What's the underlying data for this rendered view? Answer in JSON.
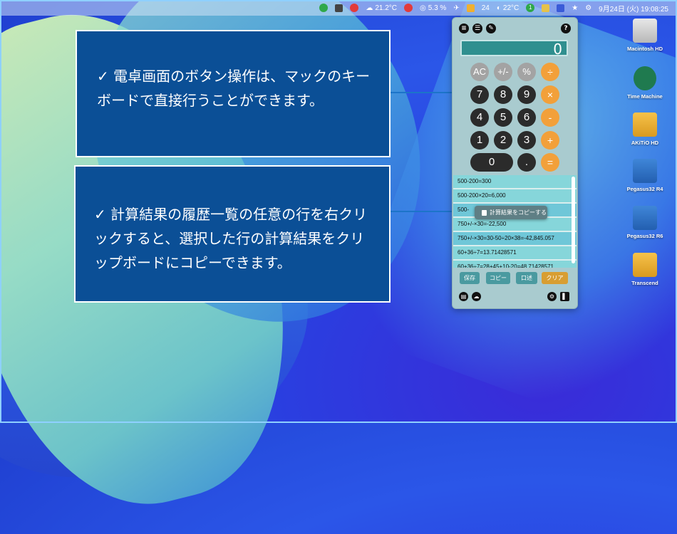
{
  "menubar": {
    "weather": "21.2°C",
    "cpu": "5.3 %",
    "date_badge": "24",
    "temperature2": "22°C",
    "badge_count": "1",
    "datetime": "9月24日 (火)  19:08:25",
    "colors": {
      "green": "#2fa84a",
      "red": "#e23b3b",
      "teal": "#27a6a0"
    }
  },
  "callouts": [
    {
      "text": "✓ 電卓画面のボタン操作は、マックのキーボードで直接行うことができます。"
    },
    {
      "text": "✓ 計算結果の履歴一覧の任意の行を右クリックすると、選択した行の計算結果をクリップボードにコピーできます。"
    }
  ],
  "calculator": {
    "display": "0",
    "help_label": "?",
    "buttons": {
      "ac": "AC",
      "sign": "+/-",
      "percent": "%",
      "divide": "÷",
      "seven": "7",
      "eight": "8",
      "nine": "9",
      "multiply": "×",
      "four": "4",
      "five": "5",
      "six": "6",
      "minus": "-",
      "one": "1",
      "two": "2",
      "three": "3",
      "plus": "+",
      "zero": "0",
      "dot": ".",
      "equals": "="
    },
    "history": [
      "500-200=300",
      "500-200×20=6,000",
      "500-",
      "750+/-×30=-22,500",
      "750+/-×30=30-50÷20×38=-42,845.057",
      "60+36÷7=13.71428571",
      "60+36÷7=28+45+10-20=48.71428571"
    ],
    "context_menu": "計算結果をコピーする",
    "actions": {
      "save": "保存",
      "copy": "コピー",
      "dictate": "口述",
      "clear": "クリア"
    },
    "colors": {
      "body": "#a9cbcf",
      "operator": "#f2a03a",
      "digit": "#2b2b2b",
      "function": "#a3a3a3",
      "display": "#2f8f8f"
    }
  },
  "desktop_icons": [
    {
      "label": "Macintosh HD"
    },
    {
      "label": "Time Machine"
    },
    {
      "label": "AKiTiO HD"
    },
    {
      "label": "Pegasus32 R4"
    },
    {
      "label": "Pegasus32 R6"
    },
    {
      "label": "Transcend"
    }
  ]
}
